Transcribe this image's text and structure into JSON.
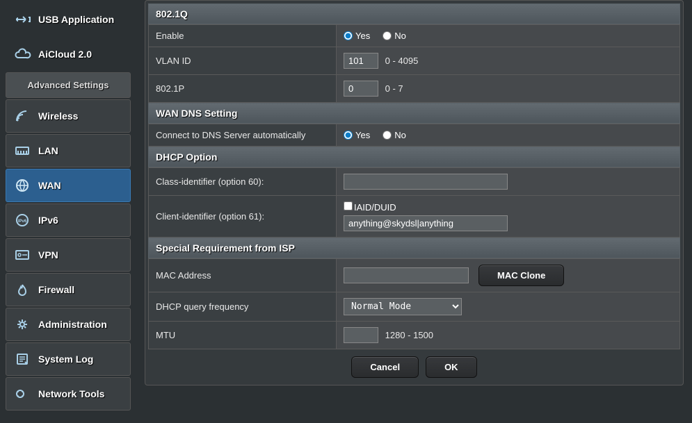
{
  "sidebar": {
    "items": [
      {
        "label": "USB Application",
        "icon": "usb"
      },
      {
        "label": "AiCloud 2.0",
        "icon": "cloud"
      }
    ],
    "header": "Advanced Settings",
    "adv": [
      {
        "label": "Wireless",
        "icon": "wifi"
      },
      {
        "label": "LAN",
        "icon": "lan"
      },
      {
        "label": "WAN",
        "icon": "globe",
        "active": true
      },
      {
        "label": "IPv6",
        "icon": "ipv6"
      },
      {
        "label": "VPN",
        "icon": "vpn"
      },
      {
        "label": "Firewall",
        "icon": "fire"
      },
      {
        "label": "Administration",
        "icon": "gear"
      },
      {
        "label": "System Log",
        "icon": "log"
      },
      {
        "label": "Network Tools",
        "icon": "tools"
      }
    ]
  },
  "sections": {
    "q8021": {
      "title": "802.1Q",
      "enable": {
        "label": "Enable",
        "yes": "Yes",
        "no": "No",
        "value": "yes"
      },
      "vlan": {
        "label": "VLAN ID",
        "value": "101",
        "hint": "0 - 4095"
      },
      "p8021": {
        "label": "802.1P",
        "value": "0",
        "hint": "0 - 7"
      }
    },
    "dns": {
      "title": "WAN DNS Setting",
      "auto": {
        "label": "Connect to DNS Server automatically",
        "yes": "Yes",
        "no": "No",
        "value": "yes"
      }
    },
    "dhcp": {
      "title": "DHCP Option",
      "opt60": {
        "label": "Class-identifier (option 60):",
        "value": ""
      },
      "opt61": {
        "label": "Client-identifier (option 61):",
        "chk": "IAID/DUID",
        "value": "anything@skydsl|anything"
      }
    },
    "isp": {
      "title": "Special Requirement from ISP",
      "mac": {
        "label": "MAC Address",
        "value": "",
        "clone": "MAC Clone"
      },
      "freq": {
        "label": "DHCP query frequency",
        "options": [
          "Normal Mode"
        ],
        "value": "Normal Mode"
      },
      "mtu": {
        "label": "MTU",
        "value": "",
        "hint": "1280 - 1500"
      }
    }
  },
  "buttons": {
    "cancel": "Cancel",
    "ok": "OK"
  }
}
